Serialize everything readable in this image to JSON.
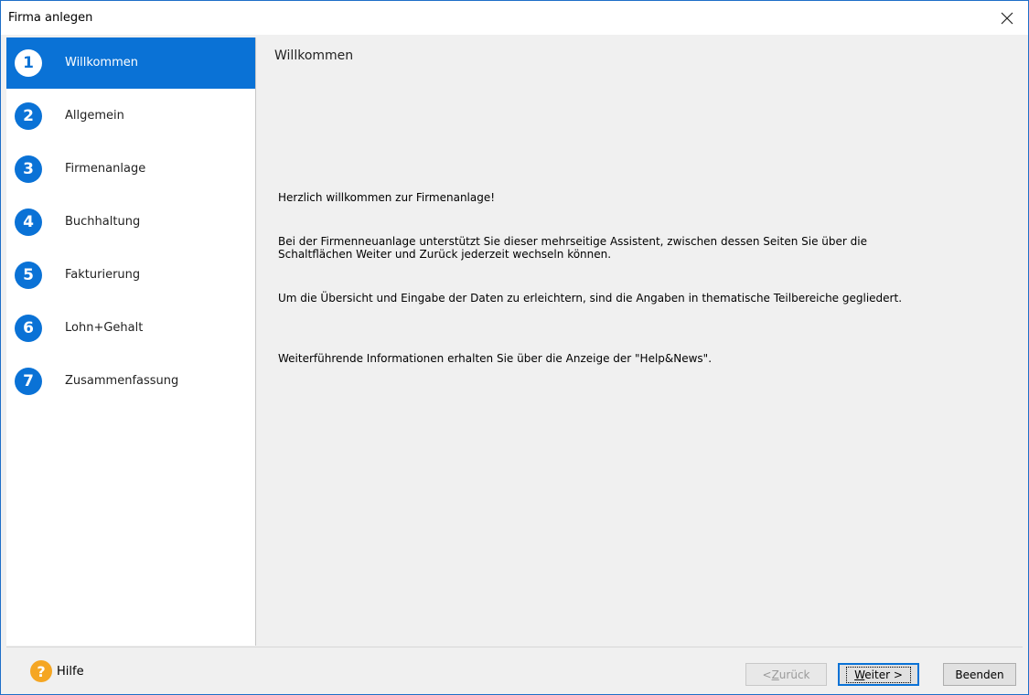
{
  "window": {
    "title": "Firma anlegen"
  },
  "sidebar": {
    "steps": [
      {
        "number": "1",
        "label": "Willkommen",
        "active": true
      },
      {
        "number": "2",
        "label": "Allgemein",
        "active": false
      },
      {
        "number": "3",
        "label": "Firmenanlage",
        "active": false
      },
      {
        "number": "4",
        "label": "Buchhaltung",
        "active": false
      },
      {
        "number": "5",
        "label": "Fakturierung",
        "active": false
      },
      {
        "number": "6",
        "label": "Lohn+Gehalt",
        "active": false
      },
      {
        "number": "7",
        "label": "Zusammenfassung",
        "active": false
      }
    ]
  },
  "content": {
    "title": "Willkommen",
    "paragraphs": [
      "Herzlich willkommen zur Firmenanlage!",
      "Bei der Firmenneuanlage unterstützt Sie dieser mehrseitige Assistent, zwischen dessen Seiten Sie über die Schaltflächen Weiter und Zurück jederzeit wechseln können.",
      "Um die Übersicht und Eingabe der Daten zu erleichtern, sind die Angaben in thematische Teilbereiche gegliedert.",
      "Weiterführende Informationen erhalten  Sie über die Anzeige der \"Help&News\"."
    ]
  },
  "footer": {
    "help_label": "Hilfe",
    "back_prefix": "< ",
    "back_accel": "Z",
    "back_rest": "urück",
    "next_accel": "W",
    "next_rest": "eiter >",
    "exit_label": "Beenden"
  },
  "colors": {
    "accent": "#0a72d6",
    "help_icon": "#f5a623"
  },
  "icons": {
    "close": "close-icon",
    "help": "help-icon"
  }
}
